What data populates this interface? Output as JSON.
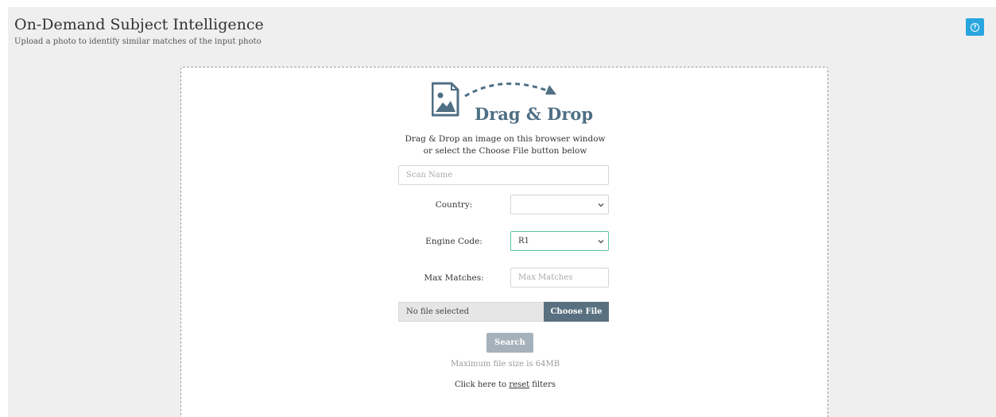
{
  "header": {
    "title": "On-Demand Subject Intelligence",
    "subtitle": "Upload a photo to identify similar matches of the input photo",
    "help_icon": "question-circle-icon"
  },
  "dropzone": {
    "title": "Drag & Drop",
    "instructions_line1": "Drag & Drop an image on this browser window",
    "instructions_line2": "or select the Choose File button below",
    "icon": "image-icon",
    "arrow_icon": "curved-dashed-arrow-icon"
  },
  "form": {
    "scan_name_placeholder": "Scan Name",
    "country_label": "Country:",
    "country_value": "",
    "engine_code_label": "Engine Code:",
    "engine_code_value": "R1",
    "max_matches_label": "Max Matches:",
    "max_matches_placeholder": "Max Matches",
    "file_status": "No file selected",
    "choose_file_label": "Choose File",
    "search_label": "Search",
    "max_file_size_text": "Maximum file size is 64MB",
    "reset_prefix": "Click here to ",
    "reset_link": "reset",
    "reset_suffix": " filters"
  },
  "colors": {
    "accent_help": "#2aa6df",
    "dropzone_title": "#4f6f84",
    "choose_file_bg": "#58707f",
    "search_bg": "#a6b2bb",
    "engine_select_border": "#5cc3a0"
  }
}
